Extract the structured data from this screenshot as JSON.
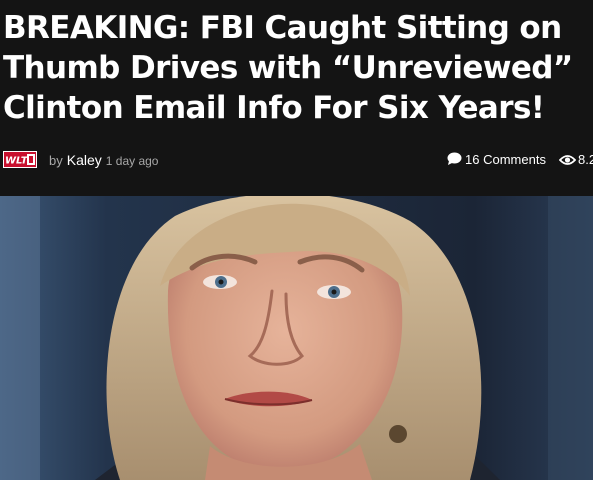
{
  "article": {
    "headline_lines": [
      "BREAKING: FBI Caught Sitting on",
      "Thumb Drives with “Unreviewed”",
      "Clinton Email Info For Six Years!"
    ],
    "byline_prefix": "by",
    "author": "Kaley",
    "posted": "1 day ago",
    "comments_count": "16",
    "comments_label": "Comments",
    "views": "8.2"
  },
  "site": {
    "logo_text": "WLT",
    "logo_icon": "wlt-site-logo"
  },
  "icons": {
    "comments": "speech-bubble-icon",
    "views": "eye-icon"
  },
  "colors": {
    "page_background": "#141414",
    "headline": "#ffffff",
    "meta_text": "#a8a8a8",
    "logo_red": "#c8102e"
  },
  "hero_image": {
    "alt": "photo"
  }
}
